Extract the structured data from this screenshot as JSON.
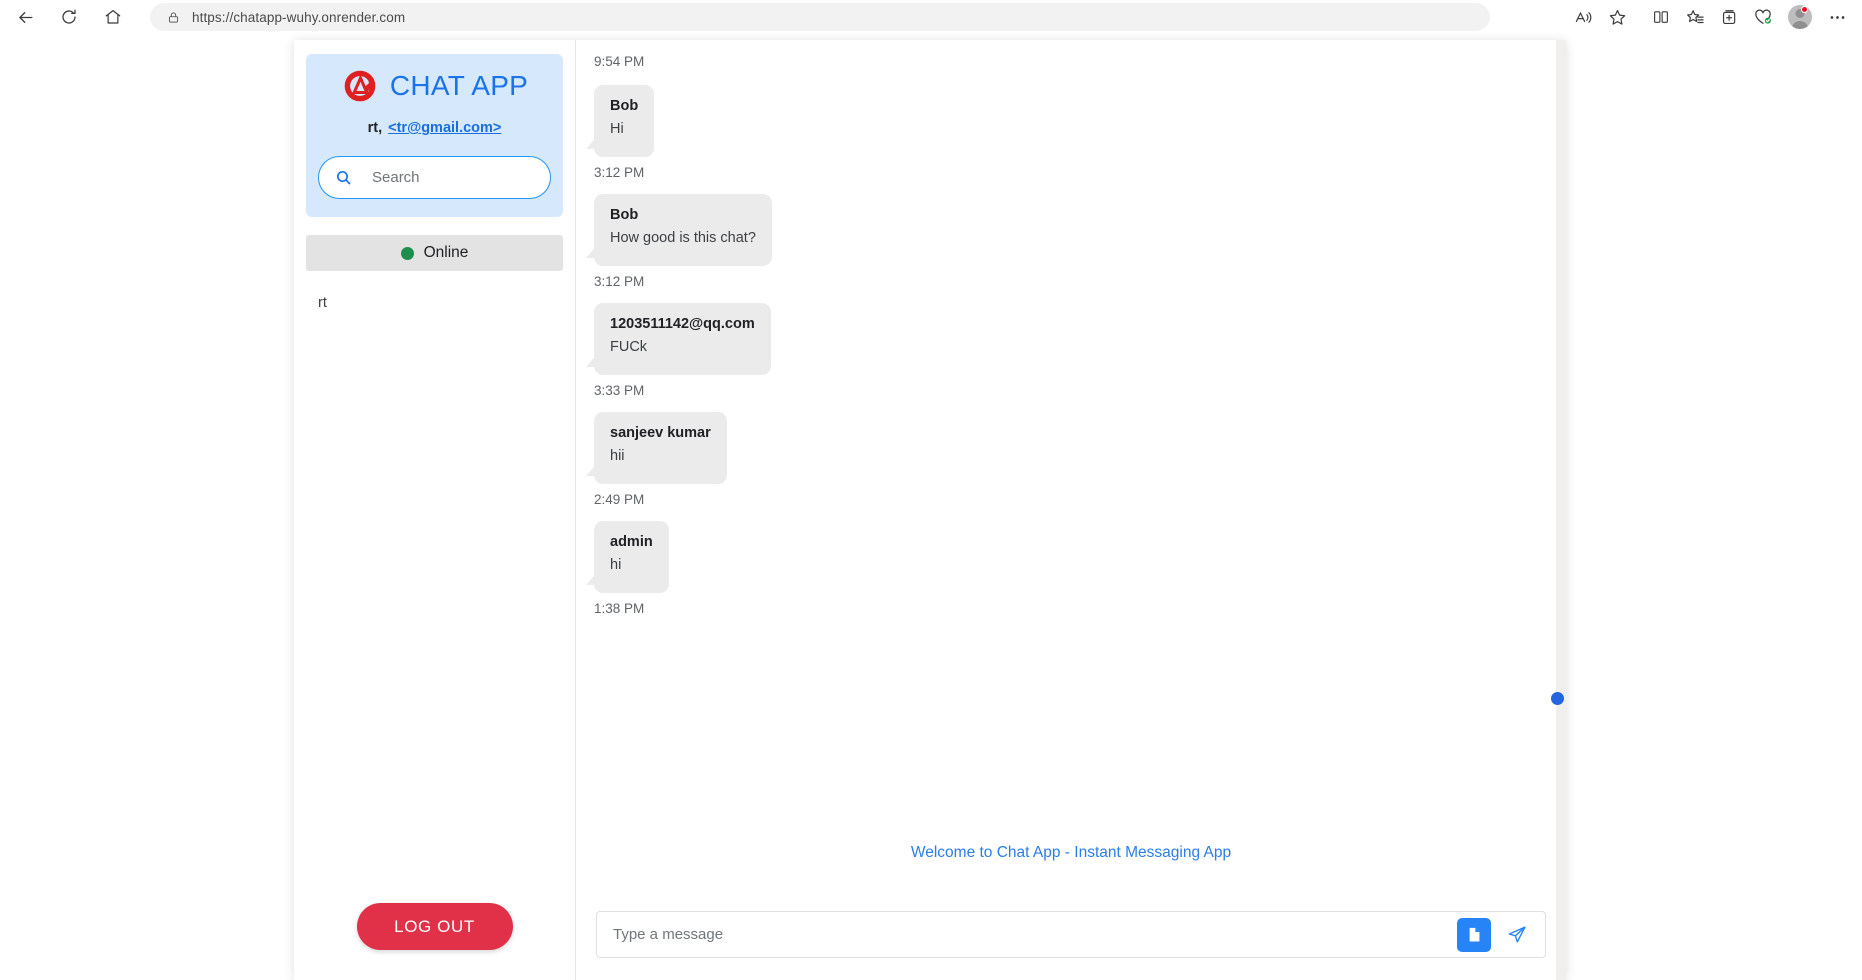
{
  "browser": {
    "url": "https://chatapp-wuhy.onrender.com",
    "back_label": "Back",
    "refresh_label": "Refresh",
    "home_label": "Home",
    "lock_icon": "lock-icon",
    "read_aloud_label": "Read aloud",
    "favorite_label": "Add this page to favorites",
    "split_screen_label": "Split screen",
    "collections_label": "Favorites",
    "add_collection_label": "Collections",
    "essentials_label": "Browser essentials",
    "profile_label": "Profile",
    "settings_label": "Settings and more"
  },
  "sidebar": {
    "brand_title": "CHAT APP",
    "brand_logo": "chat-app-logo",
    "user_name": "rt,",
    "user_email": "<tr@gmail.com>",
    "search_placeholder": "Search",
    "search_value": "",
    "status_label": "Online",
    "status_color": "#1e8e4e",
    "contacts": [
      {
        "name": "rt"
      }
    ],
    "logout_label": "LOG OUT"
  },
  "chat": {
    "top_time": "9:54 PM",
    "messages": [
      {
        "sender": "Bob",
        "text": "Hi",
        "time": "3:12 PM"
      },
      {
        "sender": "Bob",
        "text": "How good is this chat?",
        "time": "3:12 PM"
      },
      {
        "sender": "1203511142@qq.com",
        "text": "FUCk",
        "time": "3:33 PM"
      },
      {
        "sender": "sanjeev kumar",
        "text": "hii",
        "time": "2:49 PM"
      },
      {
        "sender": "admin",
        "text": "hi",
        "time": "1:38 PM"
      }
    ],
    "welcome_text": "Welcome to Chat App - Instant Messaging App",
    "input_placeholder": "Type a message",
    "input_value": "",
    "attach_label": "Attach file",
    "send_label": "Send"
  }
}
